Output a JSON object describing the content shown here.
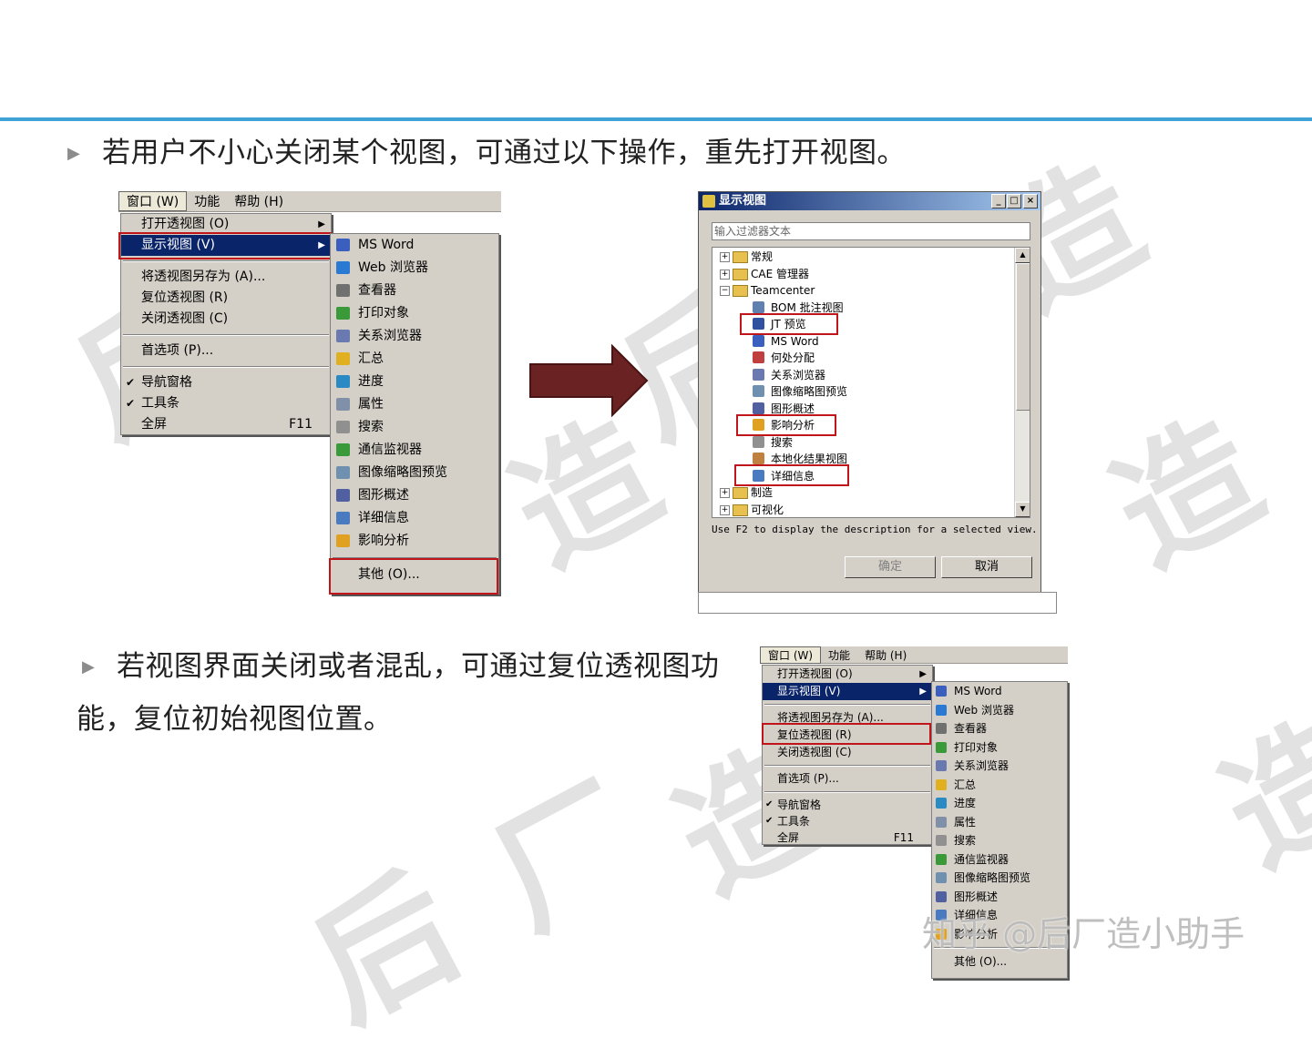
{
  "para1": "若用户不小心关闭某个视图，可通过以下操作，重先打开视图。",
  "para2_line1": "若视图界面关闭或者混乱，可通过复位透视图功",
  "para2_line2": "能，复位初始视图位置。",
  "bullet_glyph": "▶",
  "accent_color": "#3fa3d6",
  "highlight_color": "#c0161b",
  "watermark": {
    "chars": [
      "后",
      "厂",
      "造"
    ],
    "credit": "知乎 @后厂造小助手"
  },
  "menubar": {
    "items": [
      "窗口 (W)",
      "功能",
      "帮助 (H)"
    ]
  },
  "window_menu": {
    "group1": [
      {
        "label": "打开透视图 (O)",
        "arrow": "▶"
      },
      {
        "label": "显示视图 (V)",
        "arrow": "▶"
      }
    ],
    "group2": [
      "将透视图另存为 (A)...",
      "复位透视图 (R)",
      "关闭透视图 (C)"
    ],
    "group3": [
      "首选项 (P)..."
    ],
    "group4": [
      {
        "label": "导航窗格",
        "check": "✔"
      },
      {
        "label": "工具条",
        "check": "✔"
      },
      {
        "label": "全屏",
        "shortcut": "F11"
      }
    ]
  },
  "view_submenu": {
    "items": [
      {
        "label": "MS Word",
        "color": "#3b5fbf"
      },
      {
        "label": "Web 浏览器",
        "color": "#2a7ad4"
      },
      {
        "label": "查看器",
        "color": "#707070"
      },
      {
        "label": "打印对象",
        "color": "#3a9a3a"
      },
      {
        "label": "关系浏览器",
        "color": "#6a7ab0"
      },
      {
        "label": "汇总",
        "color": "#e0b020"
      },
      {
        "label": "进度",
        "color": "#2a8ac4"
      },
      {
        "label": "属性",
        "color": "#8090a8"
      },
      {
        "label": "搜索",
        "color": "#909090"
      },
      {
        "label": "通信监视器",
        "color": "#3a9a3a"
      },
      {
        "label": "图像缩略图预览",
        "color": "#7090b0"
      },
      {
        "label": "图形概述",
        "color": "#5060a0"
      },
      {
        "label": "详细信息",
        "color": "#4a7ac0"
      },
      {
        "label": "影响分析",
        "color": "#e0a020"
      }
    ],
    "other": "其他 (O)..."
  },
  "dialog": {
    "title": "显示视图",
    "filter_placeholder": "输入过滤器文本",
    "tree": {
      "folders": [
        "常规",
        "CAE 管理器",
        "Teamcenter"
      ],
      "items": [
        {
          "label": "BOM 批注视图",
          "color": "#6080b0"
        },
        {
          "label": "JT 预览",
          "color": "#3050a0"
        },
        {
          "label": "MS Word",
          "color": "#3b5fbf"
        },
        {
          "label": "何处分配",
          "color": "#c04040"
        },
        {
          "label": "关系浏览器",
          "color": "#6a7ab0"
        },
        {
          "label": "图像缩略图预览",
          "color": "#7090b0"
        },
        {
          "label": "图形概述",
          "color": "#5060a0"
        },
        {
          "label": "影响分析",
          "color": "#e0a020"
        },
        {
          "label": "搜索",
          "color": "#909090"
        },
        {
          "label": "本地化结果视图",
          "color": "#c08040"
        },
        {
          "label": "详细信息",
          "color": "#4a7ac0"
        }
      ],
      "bottom_folders": [
        "制造",
        "可视化"
      ]
    },
    "hint": "Use F2 to display the description for a selected view.",
    "ok": "确定",
    "cancel": "取消"
  }
}
